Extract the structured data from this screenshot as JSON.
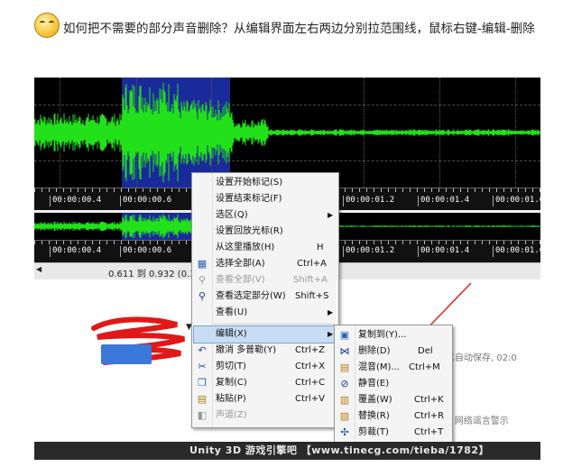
{
  "post": {
    "text": "如何把不需要的部分声音删除？从编辑界面左右两边分别拉范围线，鼠标右键-编辑-删除"
  },
  "icons": {
    "smiley": "smiley-emoticon-icon"
  },
  "timeline": {
    "ticks_main": [
      "00:00:00.4",
      "00:00:00.6",
      "00:00:01.2",
      "00:00:01.4",
      "00:00:01.6"
    ],
    "ticks_overview": [
      "00:00:00.4",
      "00:00:00.6",
      "00:00:01.2",
      "00:00:01.4",
      "00:00:01.6"
    ]
  },
  "status": {
    "selection": "0.611 到 0.932 (0.321"
  },
  "page_bg": {
    "autosave": "内容已自动保存, 02:0",
    "footer": "虚 | 网络谣言警示"
  },
  "watermark": "Unity 3D 游戏引擎吧 【www.tinecg.com/tieba/1782】",
  "context_menu": {
    "items": [
      {
        "label": "设置开始标记(S)",
        "shortcut": ""
      },
      {
        "label": "设置结束标记(F)",
        "shortcut": ""
      },
      {
        "label": "选区(Q)",
        "shortcut": ""
      },
      {
        "label": "设置回放光标(R)",
        "shortcut": ""
      },
      {
        "label": "从这里播放(H)",
        "shortcut": "H"
      },
      {
        "label": "选择全部(A)",
        "shortcut": "Ctrl+A"
      },
      {
        "label": "查看全部(V)",
        "shortcut": "Shift+A"
      },
      {
        "label": "查看选定部分(W)",
        "shortcut": "Shift+S"
      },
      {
        "label": "查看(U)",
        "shortcut": ""
      },
      {
        "label": "编辑(X)",
        "shortcut": ""
      },
      {
        "label": "撤消 多普勒(Y)",
        "shortcut": "Ctrl+Z"
      },
      {
        "label": "剪切(T)",
        "shortcut": "Ctrl+X"
      },
      {
        "label": "复制(C)",
        "shortcut": "Ctrl+C"
      },
      {
        "label": "粘贴(P)",
        "shortcut": "Ctrl+V"
      },
      {
        "label": "声道(Z)",
        "shortcut": ""
      }
    ]
  },
  "edit_submenu": {
    "items": [
      {
        "label": "复制到(Y)...",
        "shortcut": ""
      },
      {
        "label": "删除(D)",
        "shortcut": "Del"
      },
      {
        "label": "混音(M)...",
        "shortcut": "Ctrl+M"
      },
      {
        "label": "静音(E)",
        "shortcut": ""
      },
      {
        "label": "覆盖(W)",
        "shortcut": "Ctrl+K"
      },
      {
        "label": "替换(R)",
        "shortcut": "Ctrl+R"
      },
      {
        "label": "剪裁(T)",
        "shortcut": "Ctrl+T"
      }
    ]
  },
  "colors": {
    "waveform": "#22e01a",
    "selection": "#1a2a9a",
    "annotation": "#e02020",
    "highlight": "#c8ddf3"
  }
}
